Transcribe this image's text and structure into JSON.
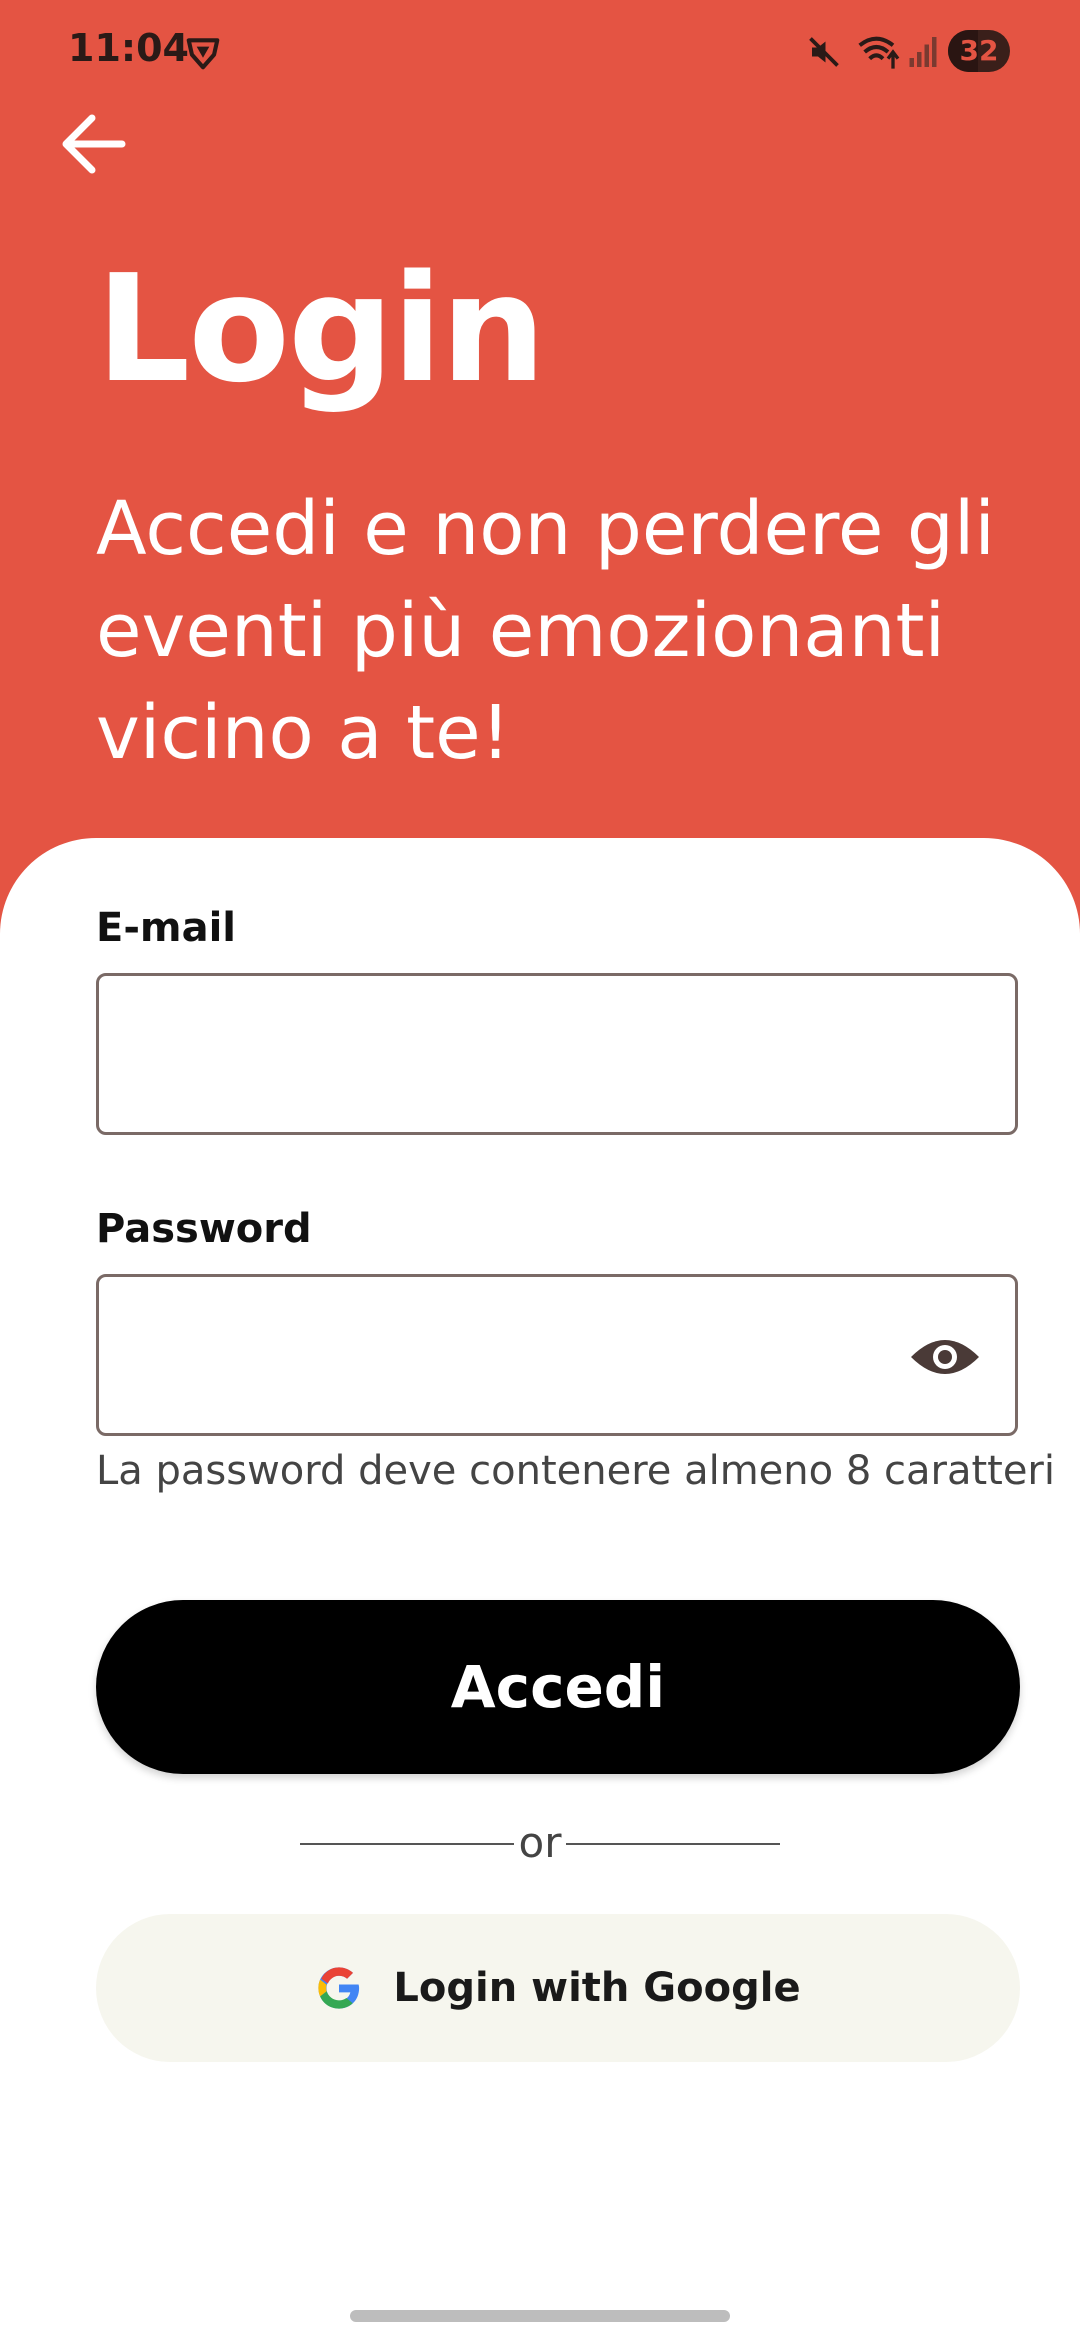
{
  "status_bar": {
    "time": "11:04",
    "battery": "32",
    "icons": [
      "shield-icon",
      "mute-icon",
      "wifi-icon",
      "signal-icon",
      "battery-icon"
    ]
  },
  "header": {
    "title": "Login",
    "subtitle": "Accedi e non perdere gli eventi più emozionanti vicino a te!",
    "background_color": "#E45443",
    "back_icon": "arrow-left-icon"
  },
  "form": {
    "email_label": "E-mail",
    "email_value": "",
    "password_label": "Password",
    "password_value": "",
    "password_helper": "La password deve contenere almeno 8 caratteri",
    "visibility_icon": "eye-icon"
  },
  "actions": {
    "submit_label": "Accedi",
    "divider_text": "or",
    "google_label": "Login with Google",
    "google_icon": "google-icon"
  }
}
